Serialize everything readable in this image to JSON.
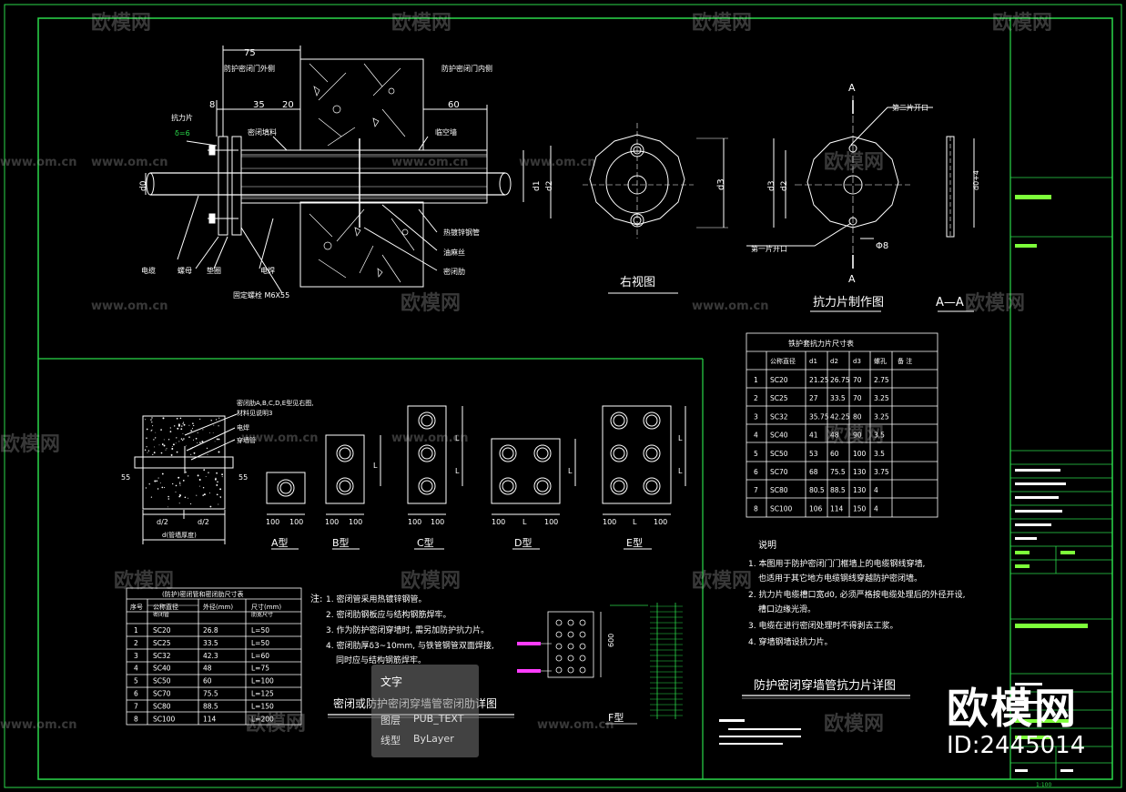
{
  "watermark": {
    "brand": "欧模网",
    "url": "www.om.cn"
  },
  "brand_overlay": {
    "name": "欧模网",
    "id": "ID:2445014"
  },
  "tooltip": {
    "title": "文字",
    "layer_label": "图层",
    "layer_value": "PUB_TEXT",
    "linetype_label": "线型",
    "linetype_value": "ByLayer"
  },
  "section_view": {
    "dim_75": "75",
    "dim_8": "8",
    "dim_35": "35",
    "dim_20": "20",
    "dim_60": "60",
    "outer_side": "防护密闭门外侧",
    "inner_side": "防护密闭门内侧",
    "force_plate": "抗力片",
    "delta": "δ=6",
    "seal_filler": "密闭填料",
    "wall": "临空墙",
    "d0": "d0",
    "d1": "d1",
    "d2": "d2",
    "hot_galv": "热镀锌钢管",
    "oil_hemp": "油麻丝",
    "seal_ring": "密闭肋",
    "cable": "电缆",
    "nut": "螺母",
    "washer": "垫圈",
    "weld": "电焊",
    "bolt": "固定螺栓 M6X55"
  },
  "right_view": {
    "d3": "d3",
    "title": "右视图"
  },
  "plate_view": {
    "second_open": "第二片开口",
    "first_open": "第一片开口",
    "d3": "d3",
    "d2": "d2",
    "phi8": "Φ8",
    "a_top": "A",
    "a_bottom": "A",
    "d0_plus": "d0+4",
    "title": "抗力片制作图",
    "aa_title": "A—A"
  },
  "table1": {
    "title": "铁护套抗力片尺寸表",
    "headers": [
      "",
      "公称直径",
      "d1",
      "d2",
      "d3",
      "螺孔",
      "备 注"
    ],
    "rows": [
      [
        "1",
        "SC20",
        "21.25",
        "26.75",
        "70",
        "2.75",
        ""
      ],
      [
        "2",
        "SC25",
        "27",
        "33.5",
        "70",
        "3.25",
        ""
      ],
      [
        "3",
        "SC32",
        "35.75",
        "42.25",
        "80",
        "3.25",
        ""
      ],
      [
        "4",
        "SC40",
        "41",
        "48",
        "90",
        "3.5",
        ""
      ],
      [
        "5",
        "SC50",
        "53",
        "60",
        "100",
        "3.5",
        ""
      ],
      [
        "6",
        "SC70",
        "68",
        "75.5",
        "130",
        "3.75",
        ""
      ],
      [
        "7",
        "SC80",
        "80.5",
        "88.5",
        "130",
        "4",
        ""
      ],
      [
        "8",
        "SC100",
        "106",
        "114",
        "150",
        "4",
        ""
      ]
    ]
  },
  "notes_right": {
    "title": "说明",
    "lines": [
      "1. 本图用于防护密闭门门框墙上的电缆钢线穿墙,",
      "也适用于其它地方电缆钢线穿越防护密闭墙。",
      "2. 抗力片电缆槽口宽d0, 必须严格按电缆处理后的外径开设,",
      "槽口边缘光滑。",
      "3. 电缆在进行密闭处理时不得剥去工浆。",
      "4. 穿墙钢墙设抗力片。"
    ],
    "heading": "防护密闭穿墙管抗力片详图"
  },
  "ring_detail": {
    "note1": "密闭肋A,B,C,D,E型见右图,",
    "note2": "材料见说明3",
    "electric": "电焊",
    "pipe": "穿墙管",
    "dim_55a": "55",
    "dim_55b": "55",
    "d_half1": "d/2",
    "d_half2": "d/2",
    "d_total": "d(管墙厚度)"
  },
  "types": [
    {
      "label": "A型"
    },
    {
      "label": "B型"
    },
    {
      "label": "C型"
    },
    {
      "label": "D型"
    },
    {
      "label": "E型"
    },
    {
      "label": "F型"
    }
  ],
  "dims": {
    "d100": "100",
    "dL": "L",
    "d600": "600"
  },
  "table2": {
    "title": "(防护)密闭管和密闭肋尺寸表",
    "headers": [
      "序号",
      "公称直径",
      "外径(mm)",
      "尺寸(mm)"
    ],
    "subheaders": [
      "",
      "密闭管",
      "",
      "肋宽尺寸"
    ],
    "rows": [
      [
        "1",
        "SC20",
        "26.8",
        "L=50"
      ],
      [
        "2",
        "SC25",
        "33.5",
        "L=50"
      ],
      [
        "3",
        "SC32",
        "42.3",
        "L=60"
      ],
      [
        "4",
        "SC40",
        "48",
        "L=75"
      ],
      [
        "5",
        "SC50",
        "60",
        "L=100"
      ],
      [
        "6",
        "SC70",
        "75.5",
        "L=125"
      ],
      [
        "7",
        "SC80",
        "88.5",
        "L=150"
      ],
      [
        "8",
        "SC100",
        "114",
        "L=200"
      ]
    ]
  },
  "notes_mid": {
    "lead": "注:",
    "lines": [
      "1. 密闭管采用热镀锌钢管。",
      "2. 密闭肋钢板应与结构钢筋焊牢。",
      "3. 作为防护密闭穿墙时, 需另加防护抗力片。",
      "4. 密闭肋厚δ3~10mm, 与铁管钢管双面焊接,",
      "同时应与结构钢筋焊牢。"
    ],
    "heading": "密闭或防护密闭穿墙管密闭肋详图"
  },
  "titleblock": {
    "scale": "1:100"
  },
  "colors": {
    "frame": "#2ad94a",
    "line": "#ffffff",
    "cyan": "#00e5ff",
    "magenta": "#ff3cff",
    "highlight": "#7dff3a"
  }
}
